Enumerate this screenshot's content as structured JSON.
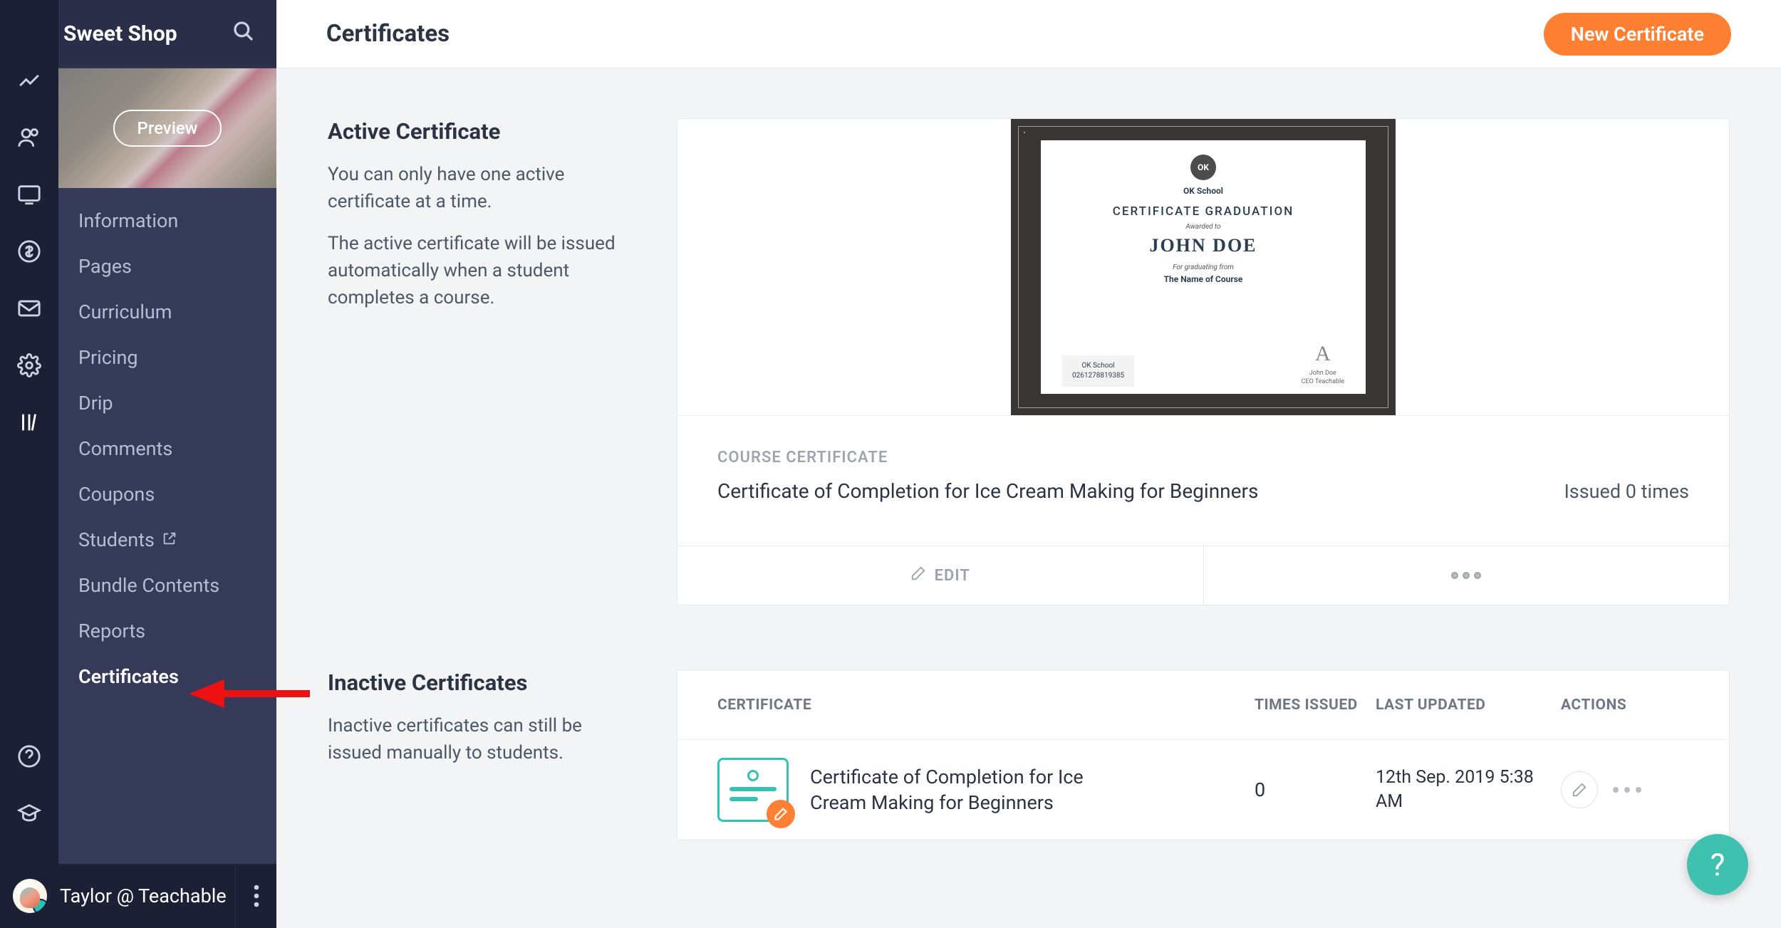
{
  "school_name": "The Sweet Shop",
  "rail": {
    "items": [
      {
        "name": "analytics",
        "label": "Analytics"
      },
      {
        "name": "users",
        "label": "Users"
      },
      {
        "name": "site",
        "label": "Site"
      },
      {
        "name": "sales",
        "label": "Sales"
      },
      {
        "name": "emails",
        "label": "Emails"
      },
      {
        "name": "settings",
        "label": "Settings"
      },
      {
        "name": "courses",
        "label": "Courses"
      }
    ],
    "bottom": [
      {
        "name": "help",
        "label": "Help"
      },
      {
        "name": "grad",
        "label": "Teachable"
      }
    ]
  },
  "subnav": {
    "preview_label": "Preview",
    "items": [
      {
        "label": "Information"
      },
      {
        "label": "Pages"
      },
      {
        "label": "Curriculum"
      },
      {
        "label": "Pricing"
      },
      {
        "label": "Drip"
      },
      {
        "label": "Comments"
      },
      {
        "label": "Coupons"
      },
      {
        "label": "Students",
        "external": true
      },
      {
        "label": "Bundle Contents"
      },
      {
        "label": "Reports"
      },
      {
        "label": "Certificates"
      }
    ],
    "active_index": 10
  },
  "user": {
    "display": "Taylor @ Teachable"
  },
  "header": {
    "title": "Certificates",
    "new_button": "New Certificate"
  },
  "active_section": {
    "heading": "Active Certificate",
    "p1": "You can only have one active certificate at a time.",
    "p2": "The active certificate will be issued automatically when a student completes a course."
  },
  "active_cert": {
    "eyebrow": "COURSE CERTIFICATE",
    "title": "Certificate of Completion for Ice Cream Making for Beginners",
    "issued": "Issued 0 times",
    "edit_label": "EDIT",
    "preview": {
      "ok": "OK",
      "ok_school": "OK School",
      "headline": "CERTIFICATE GRADUATION",
      "awarded": "Awarded to",
      "name": "JOHN DOE",
      "for": "For graduating from",
      "course": "The Name of Course",
      "stamp_line1": "OK School",
      "stamp_line2": "0261278819385",
      "sig_name": "John Doe",
      "sig_title": "CEO Teachable"
    }
  },
  "inactive_section": {
    "heading": "Inactive Certificates",
    "p1": "Inactive certificates can still be issued manually to students."
  },
  "inactive_table": {
    "columns": [
      "CERTIFICATE",
      "TIMES ISSUED",
      "LAST UPDATED",
      "ACTIONS"
    ],
    "rows": [
      {
        "title": "Certificate of Completion for Ice Cream Making for Beginners",
        "times_issued": "0",
        "last_updated": "12th Sep. 2019 5:38 AM"
      }
    ]
  },
  "fab_label": "?"
}
